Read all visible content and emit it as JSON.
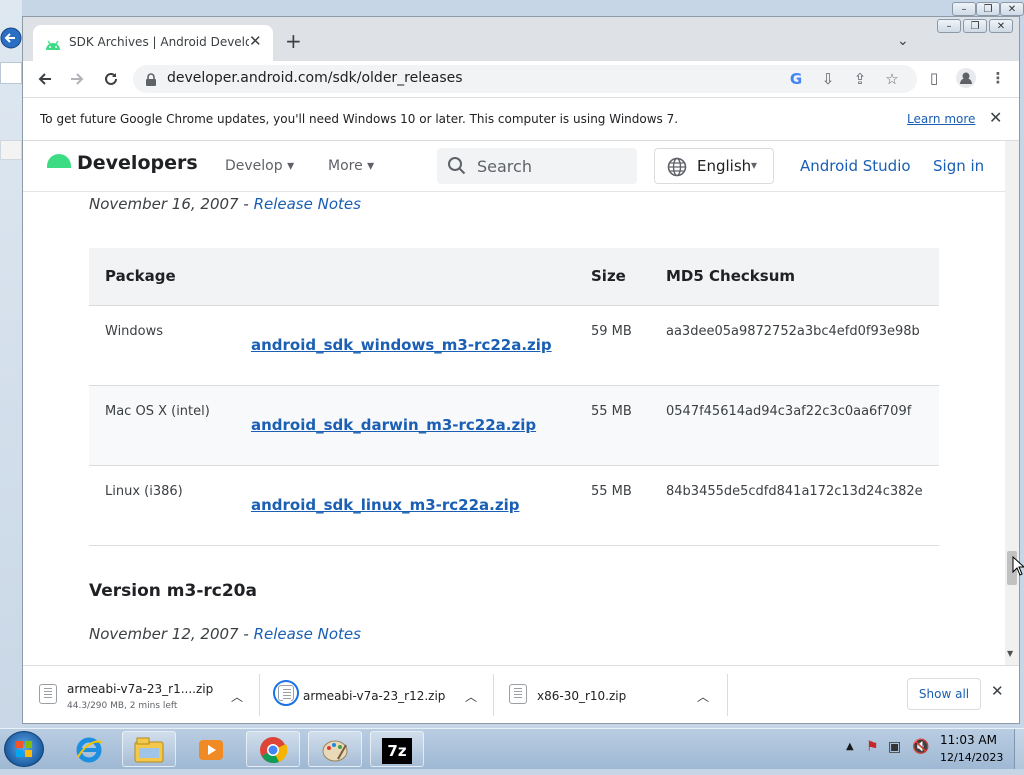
{
  "browser": {
    "tab_title": "SDK Archives  |  Android Develop",
    "tab_close": "✕",
    "new_tab": "+",
    "tab_search": "⌄",
    "url": "developer.android.com/sdk/older_releases",
    "infobar": {
      "text": "To get future Google Chrome updates, you'll need Windows 10 or later. This computer is using Windows 7.",
      "learn_more": "Learn more",
      "close": "✕"
    }
  },
  "site_nav": {
    "logo": "Developers",
    "develop": "Develop",
    "more": "More",
    "search_placeholder": "Search",
    "language": "English",
    "android_studio": "Android Studio",
    "sign_in": "Sign in"
  },
  "release_top": {
    "date": "November 16, 2007",
    "separator": " - ",
    "notes_link": "Release Notes"
  },
  "table": {
    "headers": [
      "Package",
      "Size",
      "MD5 Checksum"
    ],
    "rows": [
      {
        "platform": "Windows",
        "file": "android_sdk_windows_m3-rc22a.zip",
        "size": "59 MB",
        "md5": "aa3dee05a9872752a3bc4efd0f93e98b"
      },
      {
        "platform": "Mac OS X (intel)",
        "file": "android_sdk_darwin_m3-rc22a.zip",
        "size": "55 MB",
        "md5": "0547f45614ad94c3af22c3c0aa6f709f"
      },
      {
        "platform": "Linux (i386)",
        "file": "android_sdk_linux_m3-rc22a.zip",
        "size": "55 MB",
        "md5": "84b3455de5cdfd841a172c13d24c382e"
      }
    ]
  },
  "next_version": {
    "title": "Version m3-rc20a",
    "date": "November 12, 2007",
    "separator": " - ",
    "notes_link": "Release Notes"
  },
  "downloads": {
    "items": [
      {
        "name": "armeabi-v7a-23_r1....zip",
        "status": "44.3/290 MB, 2 mins left"
      },
      {
        "name": "armeabi-v7a-23_r12.zip",
        "status": ""
      },
      {
        "name": "x86-30_r10.zip",
        "status": ""
      }
    ],
    "show_all": "Show all",
    "close": "✕"
  },
  "taskbar": {
    "time": "11:03 AM",
    "date": "12/14/2023",
    "apps": [
      "ie-icon",
      "explorer-icon",
      "media-player-icon",
      "chrome-icon",
      "paint-icon",
      "7zip-icon"
    ],
    "sevenzip_label": "7z"
  },
  "colors": {
    "link": "#1a5fb4",
    "android_green": "#3ddc84",
    "tabstrip": "#dee1e6"
  }
}
